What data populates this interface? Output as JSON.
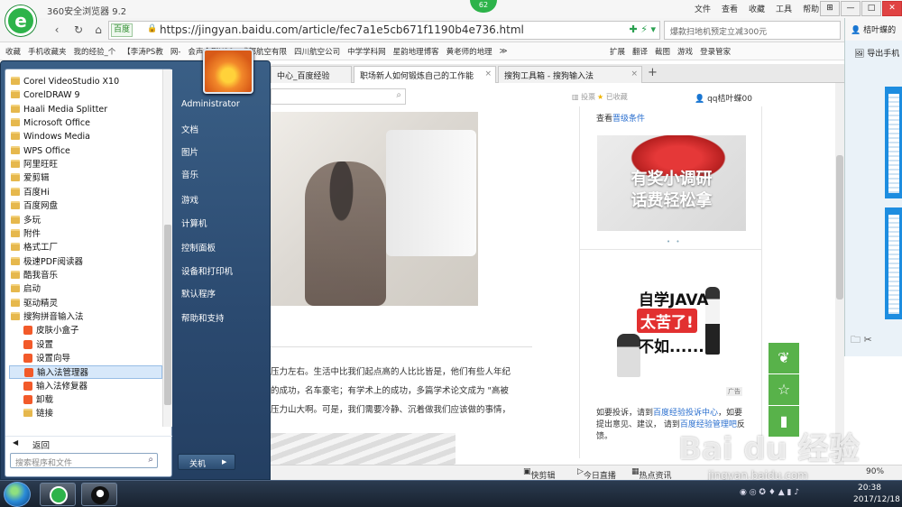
{
  "browser": {
    "title": "360安全浏览器 9.2",
    "badge": "62",
    "menu": [
      "文件",
      "查看",
      "收藏",
      "工具",
      "帮助"
    ],
    "window_controls": [
      "⊞",
      "—",
      "□",
      "✕"
    ],
    "address": {
      "engine": "百度",
      "url": "https://jingyan.baidu.com/article/fec7a1e5cb671f1190b4e736.html"
    },
    "search_box": "爆款扫地机预定立减300元",
    "favorites": [
      "收藏",
      "手机收藏夹",
      "我的经验_个",
      "【李涛PS教",
      "网-",
      "会声会影X10",
      "成都航空有限",
      "四川航空公司",
      "中学学科网",
      "星韵地理博客",
      "黄老师的地理",
      "≫"
    ],
    "favorites_right": [
      "扩展",
      "翻译",
      "截图",
      "游戏",
      "登录管家"
    ],
    "tabs": [
      {
        "label": "中心_百度经验"
      },
      {
        "label": "职场新人如何锻炼自己的工作能"
      },
      {
        "label": "搜狗工具箱 - 搜狗输入法"
      }
    ],
    "new_tab": "+"
  },
  "page": {
    "vote": "投票",
    "collect": "已收藏",
    "user": "qq桔叶蝶00",
    "photo_watermark": "百度经验",
    "check_conditions": {
      "prefix": "查看",
      "link": "晋级条件"
    },
    "ad1": {
      "line1": "有奖小调研",
      "line2": "话费轻松拿"
    },
    "ad2": {
      "line1": "自学JAVA",
      "line2": "太苦了!",
      "line3": "不如......"
    },
    "ad_label": "广告",
    "article_lines": [
      "压力左右。生活中比我们起点高的人比比皆是，他们有些人年纪",
      "的成功，名车豪宅；有学术上的成功，多篇学术论文成为 \"高被",
      "压力山大啊。可是，我们需要冷静、沉着做我们应该做的事情，"
    ],
    "complaint": {
      "t1": "如要投诉，请到",
      "link1": "百度经验投诉中心",
      "t2": "，如要提出意见、建议， 请到",
      "link2": "百度经验管理吧",
      "t3": "反馈。"
    }
  },
  "qq_panel": {
    "title": "桔叶蝶的",
    "export": "导出手机"
  },
  "statusbar": [
    "快剪辑",
    "今日直播",
    "热点资讯",
    "90%"
  ],
  "start_menu": {
    "programs": [
      {
        "label": "Corel VideoStudio X10",
        "type": "folder"
      },
      {
        "label": "CorelDRAW 9",
        "type": "folder"
      },
      {
        "label": "Haali Media Splitter",
        "type": "folder"
      },
      {
        "label": "Microsoft Office",
        "type": "folder"
      },
      {
        "label": "Windows Media",
        "type": "folder"
      },
      {
        "label": "WPS Office",
        "type": "folder"
      },
      {
        "label": "阿里旺旺",
        "type": "folder"
      },
      {
        "label": "爱剪辑",
        "type": "folder"
      },
      {
        "label": "百度Hi",
        "type": "folder"
      },
      {
        "label": "百度网盘",
        "type": "folder"
      },
      {
        "label": "多玩",
        "type": "folder"
      },
      {
        "label": "附件",
        "type": "folder"
      },
      {
        "label": "格式工厂",
        "type": "folder"
      },
      {
        "label": "极速PDF阅读器",
        "type": "folder"
      },
      {
        "label": "酷我音乐",
        "type": "folder"
      },
      {
        "label": "启动",
        "type": "folder"
      },
      {
        "label": "驱动精灵",
        "type": "folder"
      },
      {
        "label": "搜狗拼音输入法",
        "type": "folder"
      },
      {
        "label": "皮肤小盒子",
        "type": "app"
      },
      {
        "label": "设置",
        "type": "app"
      },
      {
        "label": "设置向导",
        "type": "app"
      },
      {
        "label": "输入法管理器",
        "type": "app",
        "highlight": true
      },
      {
        "label": "输入法修复器",
        "type": "app"
      },
      {
        "label": "卸载",
        "type": "app"
      },
      {
        "label": "链接",
        "type": "subfolder"
      }
    ],
    "back": "返回",
    "search_placeholder": "搜索程序和文件",
    "right_items": [
      "Administrator",
      "文档",
      "图片",
      "音乐",
      "游戏",
      "计算机",
      "控制面板",
      "设备和打印机",
      "默认程序",
      "帮助和支持"
    ],
    "shutdown": "关机"
  },
  "taskbar": {
    "time": "20:38",
    "date": "2017/12/18"
  },
  "watermark": {
    "main": "Bai du 经验",
    "sub": "jingyan.baidu.com"
  },
  "colors": {
    "accent_green": "#2db34a",
    "link_blue": "#2a6fcf",
    "float_green": "#58b24a"
  }
}
